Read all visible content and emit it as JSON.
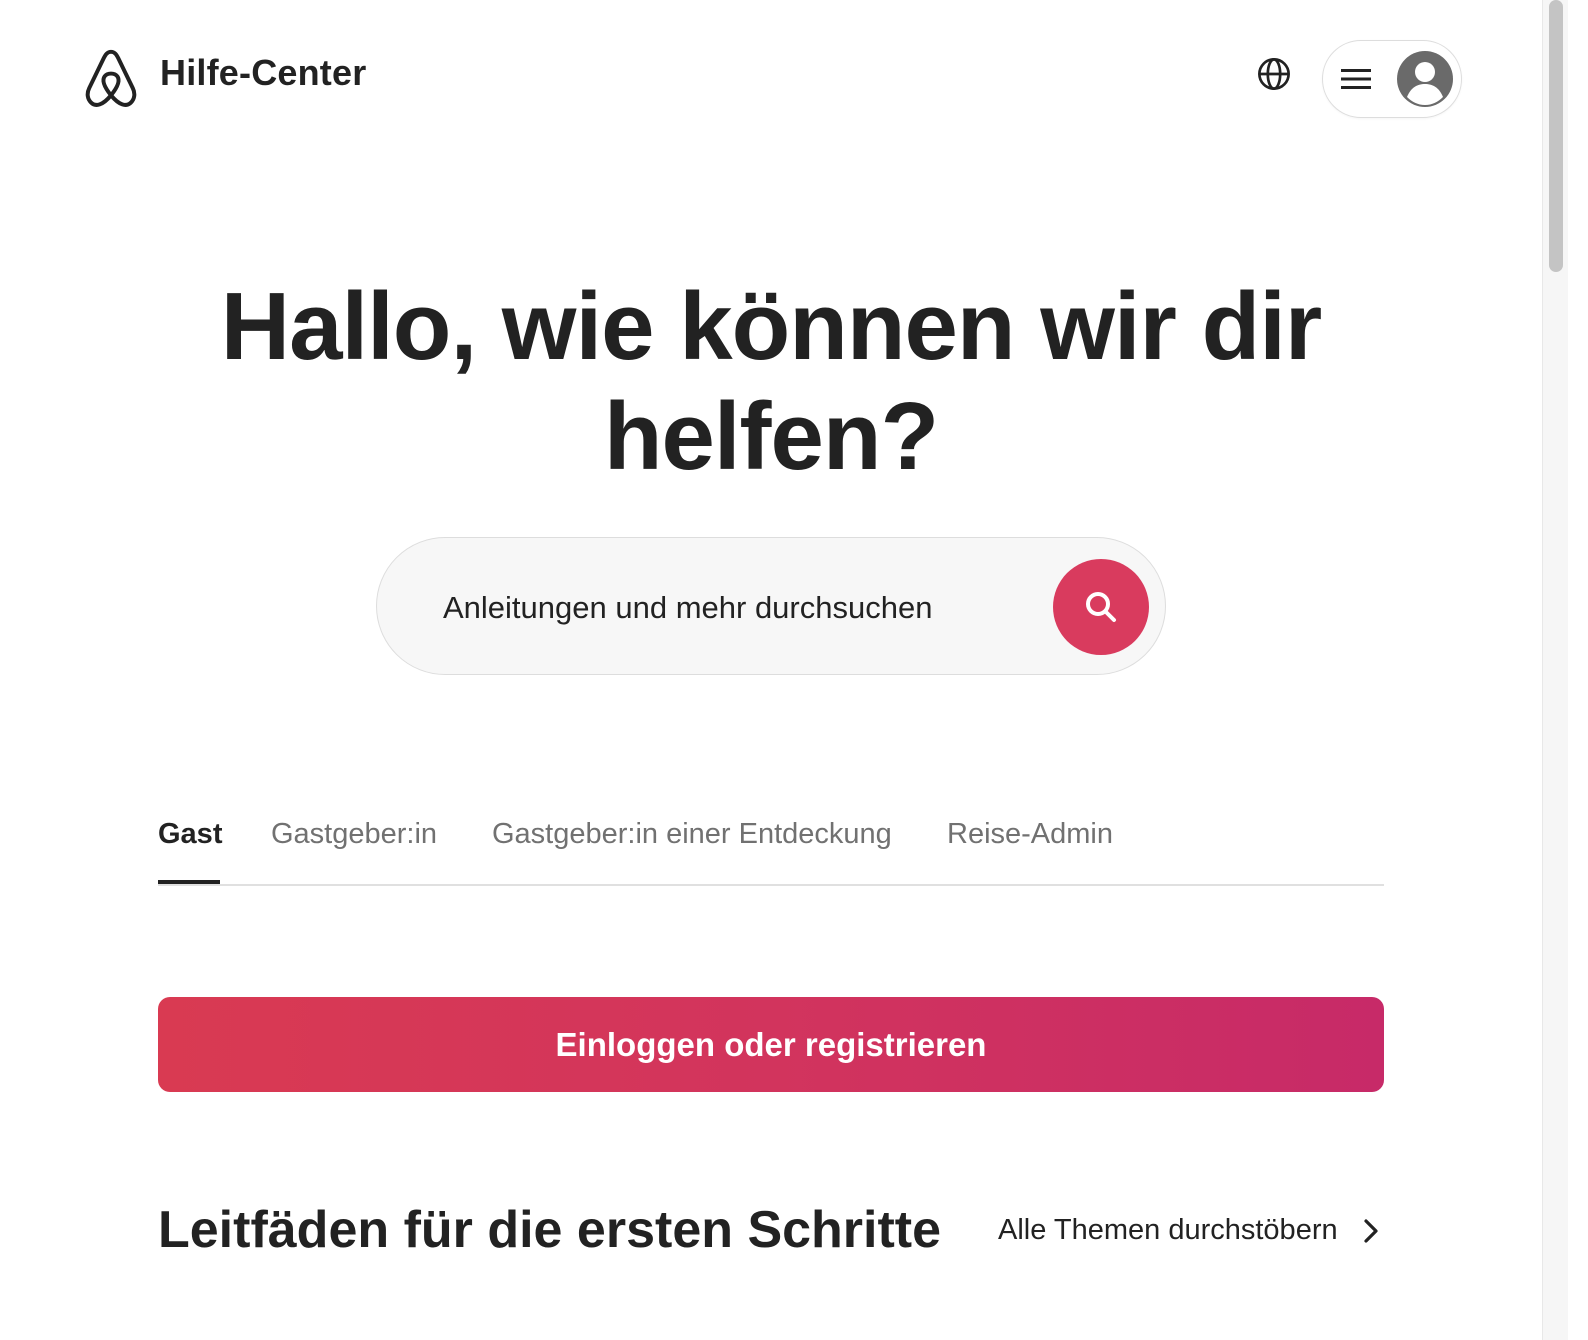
{
  "header": {
    "brand": "Hilfe-Center",
    "icons": {
      "logo": "airbnb-logo-icon",
      "language": "globe-icon",
      "menu": "hamburger-menu-icon",
      "profile": "user-avatar-icon"
    }
  },
  "hero": {
    "line1": "Hallo, wie können wir dir",
    "line2": "helfen?"
  },
  "search": {
    "placeholder": "Anleitungen und mehr durchsuchen",
    "button_icon": "search-icon"
  },
  "tabs": [
    {
      "label": "Gast",
      "active": true
    },
    {
      "label": "Gastgeber:in",
      "active": false
    },
    {
      "label": "Gastgeber:in einer Entdeckung",
      "active": false
    },
    {
      "label": "Reise-Admin",
      "active": false
    }
  ],
  "login": {
    "label": "Einloggen oder registrieren"
  },
  "guides": {
    "title": "Leitfäden für die ersten Schritte",
    "browse_label": "Alle Themen durchstöbern"
  },
  "colors": {
    "accent": "#d93b5e",
    "text": "#222222",
    "muted": "#717171"
  }
}
